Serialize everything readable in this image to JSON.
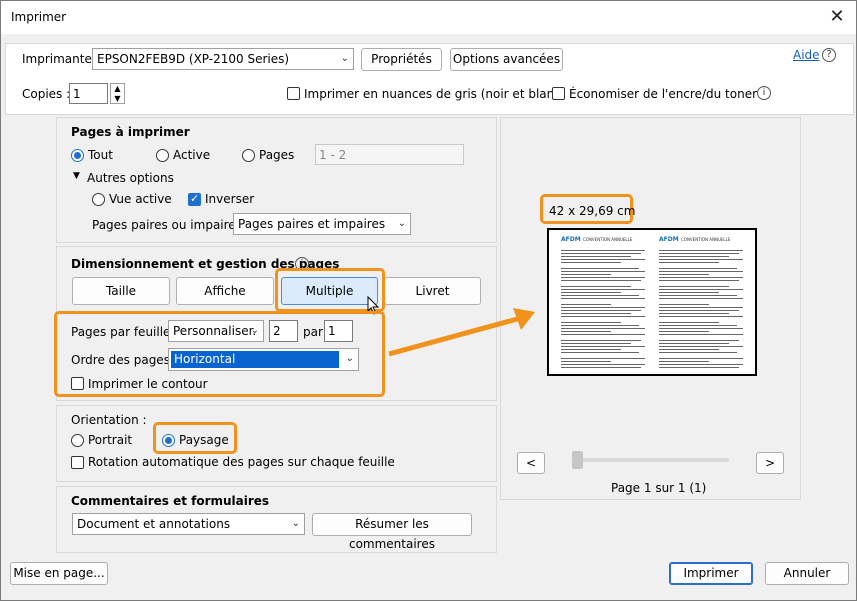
{
  "window": {
    "title": "Imprimer",
    "close_glyph": "✕"
  },
  "top": {
    "printer_label": "Imprimante :",
    "printer_value": "EPSON2FEB9D (XP-2100 Series)",
    "properties_btn": "Propriétés",
    "advanced_btn": "Options avancées",
    "help_link": "Aide",
    "copies_label": "Copies :",
    "copies_value": "1",
    "grayscale_label": "Imprimer en nuances de gris (noir et blanc)",
    "grayscale_checked": false,
    "save_ink_label": "Économiser de l'encre/du toner",
    "save_ink_checked": false
  },
  "pages": {
    "heading": "Pages à imprimer",
    "all_label": "Tout",
    "current_label": "Active",
    "pages_label": "Pages",
    "pages_value": "1 - 2",
    "selected": "all",
    "more_options": "Autres options",
    "current_view_label": "Vue active",
    "reverse_label": "Inverser",
    "reverse_checked": true,
    "odd_even_label": "Pages paires ou impaires :",
    "odd_even_value": "Pages paires et impaires"
  },
  "sizing": {
    "heading": "Dimensionnement et gestion des pages",
    "tabs": [
      "Taille",
      "Affiche",
      "Multiple",
      "Livret"
    ],
    "active_tab": "Multiple",
    "pages_per_sheet_label": "Pages par feuille :",
    "pages_per_sheet_value": "Personnaliser.",
    "cols_value": "2",
    "by_label": "par",
    "rows_value": "1",
    "order_label": "Ordre des pages :",
    "order_value": "Horizontal",
    "border_label": "Imprimer le contour",
    "border_checked": false
  },
  "orientation": {
    "heading": "Orientation :",
    "portrait_label": "Portrait",
    "landscape_label": "Paysage",
    "selected": "landscape",
    "auto_rotate_label": "Rotation automatique des pages sur chaque feuille",
    "auto_rotate_checked": false
  },
  "comments": {
    "heading": "Commentaires et formulaires",
    "value": "Document et annotations",
    "summarize_btn": "Résumer les commentaires"
  },
  "preview": {
    "size_label": "42 x 29,69 cm",
    "page_info": "Page 1 sur 1 (1)",
    "prev_glyph": "<",
    "next_glyph": ">",
    "doc_logo": "AFDM",
    "doc_title": "CONVENTION ANNUELLE"
  },
  "footer": {
    "page_setup_btn": "Mise en page...",
    "print_btn": "Imprimer",
    "cancel_btn": "Annuler"
  },
  "colors": {
    "highlight": "#f0921c",
    "accent": "#1f6fd1",
    "doc_logo": "#1a6fb4"
  }
}
